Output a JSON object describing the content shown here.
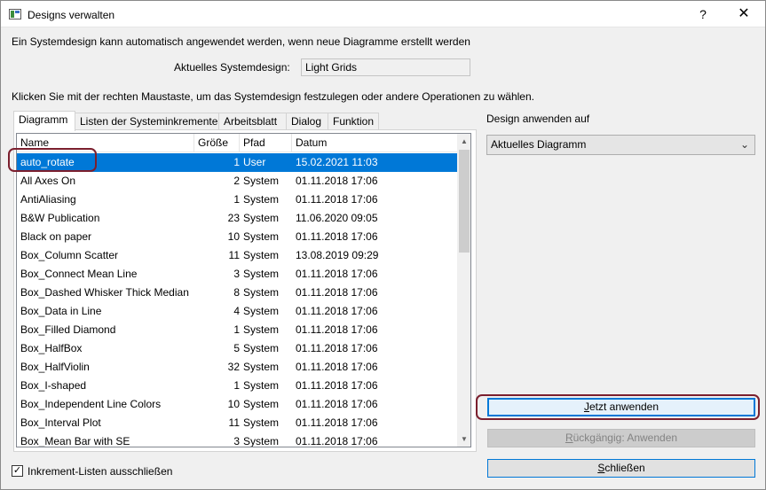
{
  "window": {
    "title": "Designs verwalten",
    "help_glyph": "?",
    "close_glyph": "✕"
  },
  "intro_text": "Ein Systemdesign kann automatisch angewendet werden, wenn neue Diagramme erstellt werden",
  "current_system": {
    "label": "Aktuelles Systemdesign:",
    "value": "Light Grids"
  },
  "instruction_text": "Klicken Sie mit der rechten Maustaste, um das Systemdesign festzulegen oder andere Operationen zu wählen.",
  "tabs": [
    {
      "label": "Diagramm",
      "active": true
    },
    {
      "label": "Listen der Systeminkremente",
      "active": false
    },
    {
      "label": "Arbeitsblatt",
      "active": false
    },
    {
      "label": "Dialog",
      "active": false
    },
    {
      "label": "Funktion",
      "active": false
    }
  ],
  "list": {
    "columns": [
      "Name",
      "Größe",
      "Pfad",
      "Datum"
    ],
    "rows": [
      {
        "name": "auto_rotate",
        "size": "1",
        "path": "User",
        "date": "15.02.2021 11:03",
        "selected": true
      },
      {
        "name": "All Axes On",
        "size": "2",
        "path": "System",
        "date": "01.11.2018 17:06"
      },
      {
        "name": "AntiAliasing",
        "size": "1",
        "path": "System",
        "date": "01.11.2018 17:06"
      },
      {
        "name": "B&W Publication",
        "size": "23",
        "path": "System",
        "date": "11.06.2020 09:05"
      },
      {
        "name": "Black on paper",
        "size": "10",
        "path": "System",
        "date": "01.11.2018 17:06"
      },
      {
        "name": "Box_Column Scatter",
        "size": "11",
        "path": "System",
        "date": "13.08.2019 09:29"
      },
      {
        "name": "Box_Connect Mean Line",
        "size": "3",
        "path": "System",
        "date": "01.11.2018 17:06"
      },
      {
        "name": "Box_Dashed Whisker Thick Median",
        "size": "8",
        "path": "System",
        "date": "01.11.2018 17:06"
      },
      {
        "name": "Box_Data in Line",
        "size": "4",
        "path": "System",
        "date": "01.11.2018 17:06"
      },
      {
        "name": "Box_Filled Diamond",
        "size": "1",
        "path": "System",
        "date": "01.11.2018 17:06"
      },
      {
        "name": "Box_HalfBox",
        "size": "5",
        "path": "System",
        "date": "01.11.2018 17:06"
      },
      {
        "name": "Box_HalfViolin",
        "size": "32",
        "path": "System",
        "date": "01.11.2018 17:06"
      },
      {
        "name": "Box_I-shaped",
        "size": "1",
        "path": "System",
        "date": "01.11.2018 17:06"
      },
      {
        "name": "Box_Independent Line Colors",
        "size": "10",
        "path": "System",
        "date": "01.11.2018 17:06"
      },
      {
        "name": "Box_Interval Plot",
        "size": "11",
        "path": "System",
        "date": "01.11.2018 17:06"
      },
      {
        "name": "Box_Mean Bar with SE",
        "size": "3",
        "path": "System",
        "date": "01.11.2018 17:06"
      }
    ]
  },
  "exclude_checkbox": {
    "label": "Inkrement-Listen ausschließen",
    "checked": true,
    "glyph": "✓"
  },
  "apply_to": {
    "label": "Design anwenden auf",
    "selected": "Aktuelles Diagramm",
    "arrow_glyph": "⌄"
  },
  "buttons": {
    "apply_mnemonic": "J",
    "apply_rest": "etzt anwenden",
    "undo_mnemonic": "R",
    "undo_rest": "ückgängig: Anwenden",
    "close_mnemonic": "S",
    "close_rest": "chließen"
  },
  "scrollbar": {
    "up_glyph": "▲",
    "down_glyph": "▼"
  },
  "colors": {
    "selection": "#0078d7",
    "highlight_frame": "#7b1f2e"
  }
}
